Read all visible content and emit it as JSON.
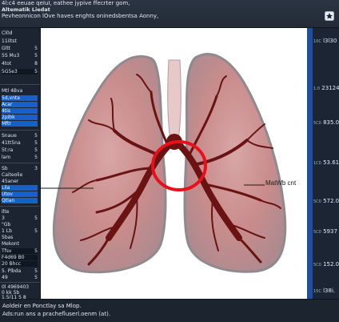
{
  "header": {
    "line1": "4l:c4 eeuae qeIuI, eathee jypive ffecrter gom,",
    "line2": "Altematik Liedat",
    "line3": "Pevheonnicon  lOve haves enghts oninedsbentsa Aonny,"
  },
  "left_panel": {
    "items": [
      {
        "label": "Cl0d",
        "value": ""
      },
      {
        "label": "11iltst",
        "value": ""
      },
      {
        "label": "Gltt",
        "value": "5"
      },
      {
        "label": "5S Mu3",
        "value": "5"
      },
      {
        "label": "4tot",
        "value": "8"
      },
      {
        "label": "5G5e3",
        "value": "5"
      },
      {
        "label": "Mtl 4Bva",
        "value": ""
      },
      {
        "label": "5d,vnta",
        "value": ""
      },
      {
        "label": "Acar",
        "value": ""
      },
      {
        "label": "4tis",
        "value": ""
      },
      {
        "label": "2pibk",
        "value": ""
      },
      {
        "label": "Mftr",
        "value": ""
      },
      {
        "label": "Snaue",
        "value": "5"
      },
      {
        "label": "41tt5na",
        "value": "5"
      },
      {
        "label": "5t:ra",
        "value": "5"
      },
      {
        "label": "lam",
        "value": "5"
      },
      {
        "label": "Sb",
        "value": "3"
      },
      {
        "label": "Caiteolie",
        "value": ""
      },
      {
        "label": "45aner",
        "value": ""
      },
      {
        "label": "Lila",
        "value": ""
      },
      {
        "label": "Utov",
        "value": ""
      },
      {
        "label": "Qtlan",
        "value": ""
      },
      {
        "label": "Ilte",
        "value": ""
      },
      {
        "label": "3",
        "value": "5"
      },
      {
        "label": "\"Gb",
        "value": ""
      },
      {
        "label": "1 Lb",
        "value": "5"
      },
      {
        "label": "5bas",
        "value": ""
      },
      {
        "label": "Mekont",
        "value": ""
      },
      {
        "label": "Tfsv",
        "value": "5"
      },
      {
        "label": "F4d69 B0",
        "value": ""
      },
      {
        "label": "20 Bhcc",
        "value": ""
      },
      {
        "label": "5. Plbda",
        "value": "5"
      },
      {
        "label": "49",
        "value": "5"
      },
      {
        "label": "0l 4969403",
        "value": ""
      },
      {
        "label": "0 kk 5b",
        "value": ""
      },
      {
        "label": "1.5/11 5 8",
        "value": ""
      }
    ]
  },
  "right_panel": {
    "labels": [
      {
        "pre": "10C",
        "value": "l3l30"
      },
      {
        "pre": "1:0",
        "value": "23124"
      },
      {
        "pre": "5C0",
        "value": "835.0"
      },
      {
        "pre": "1C0",
        "value": "53.61"
      },
      {
        "pre": "5C0",
        "value": "572.0"
      },
      {
        "pre": "5C0",
        "value": "5937"
      },
      {
        "pre": "5C0",
        "value": "152.0"
      },
      {
        "pre": "15C",
        "value": "l38i."
      }
    ]
  },
  "canvas": {
    "callout_label": "MatWb cnt"
  },
  "footer": {
    "line1": "Aoldeir en Ponctlay sa Mlop.",
    "line2": "Ads:run ans a prachefluserl.oenm (at)."
  },
  "colors": {
    "lung_fill": "#c98c8c",
    "lung_edge": "#8f8a8f",
    "airway": "#6b1212",
    "highlight_ring": "#e8101b",
    "left_blue": "#1560c9",
    "right_strip": "#1f4fa3"
  }
}
